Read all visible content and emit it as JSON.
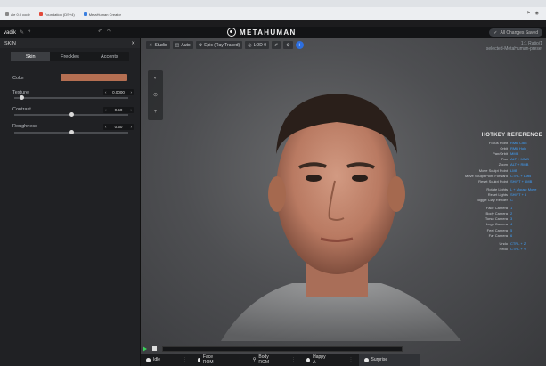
{
  "browser": {
    "bookmarks": [
      {
        "label": "ale 0.0 code",
        "color": "#888888"
      },
      {
        "label": "Foundation (DS+4)",
        "color": "#e2493a"
      },
      {
        "label": "MetaHuman Creator",
        "color": "#3a7fe0"
      }
    ]
  },
  "appbar": {
    "user": "vadik",
    "app_name": "METAHUMAN",
    "saved_label": "All Changes Saved"
  },
  "panel": {
    "title": "SKIN",
    "tabs": [
      "Skin",
      "Freckles",
      "Accents"
    ],
    "active_tab": "Skin",
    "properties": {
      "color_label": "Color",
      "skin_color": "#b56f52",
      "texture_label": "Texture",
      "texture_value": "0.0000",
      "texture_level": 0.07,
      "contrast_label": "Contrast",
      "contrast_value": "0.50",
      "contrast_level": 0.5,
      "roughness_label": "Roughness",
      "roughness_value": "0.50",
      "roughness_level": 0.5
    }
  },
  "viewport": {
    "toolbar": {
      "studio": "Studio",
      "auto": "Auto",
      "lighting": "Epic (Ray Traced)",
      "lod": "LOD 0"
    },
    "header_right": {
      "line1": "1:1 Ratio/1",
      "line2": "selected-MetaHuman-preset"
    },
    "hotkey": {
      "title": "HOTKEY REFERENCE",
      "group1": [
        {
          "key": "Focus Point",
          "value": "RMB Click"
        },
        {
          "key": "Orbit",
          "value": "RMB Hold"
        },
        {
          "key": "Pan/Orbit",
          "value": "MMB"
        },
        {
          "key": "Pan",
          "value": "ALT + MMB"
        },
        {
          "key": "Zoom",
          "value": "ALT + RMB"
        },
        {
          "key": "Move Sculpt Point",
          "value": "LMB"
        },
        {
          "key": "Move Sculpt Point Forward",
          "value": "CTRL + LMB"
        },
        {
          "key": "Reset Sculpt Point",
          "value": "SHIFT + LMB"
        }
      ],
      "group2": [
        {
          "key": "Rotate Lights",
          "value": "L + Mouse Move"
        },
        {
          "key": "Reset Lights",
          "value": "SHIFT + L"
        },
        {
          "key": "Toggle Clay Render",
          "value": "C"
        }
      ],
      "group3": [
        {
          "key": "Face Camera",
          "value": "1"
        },
        {
          "key": "Body Camera",
          "value": "2"
        },
        {
          "key": "Torso Camera",
          "value": "3"
        },
        {
          "key": "Legs Camera",
          "value": "4"
        },
        {
          "key": "Feet Camera",
          "value": "5"
        },
        {
          "key": "Far Camera",
          "value": "6"
        }
      ],
      "group4": [
        {
          "key": "Undo",
          "value": "CTRL + Z"
        },
        {
          "key": "Redo",
          "value": "CTRL + Y"
        }
      ]
    },
    "animations": [
      "Idle",
      "Face ROM",
      "Body ROM",
      "Happy A",
      "Surprise"
    ],
    "active_animation": "Surprise"
  }
}
